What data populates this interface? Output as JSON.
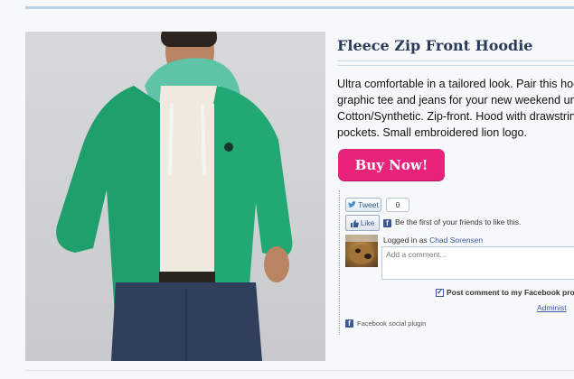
{
  "product": {
    "title": "Fleece Zip Front Hoodie",
    "description_lines": [
      "Ultra comfortable in a tailored look. Pair this hoodie",
      "graphic tee and jeans for your new weekend unifor",
      "Cotton/Synthetic. Zip-front. Hood with drawstrings.",
      "pockets. Small embroidered lion logo."
    ],
    "buy_label": "Buy Now!"
  },
  "social": {
    "tweet_label": "Tweet",
    "tweet_count": "0",
    "like_label": "Like",
    "like_text": "Be the first of your friends to like this.",
    "logged_in_prefix": "Logged in as",
    "user_name": "Chad Sorensen",
    "comment_placeholder": "Add a comment...",
    "post_to_facebook": "Post comment to my Facebook pro",
    "admin_link": "Administ",
    "plugin_label": "Facebook social plugin",
    "post_checked": true
  },
  "colors": {
    "accent": "#e8247a",
    "facebook_blue": "#3b5998",
    "title": "#2a3c5a",
    "hoodie_green": "#1fa66f"
  },
  "icons": [
    "twitter-bird-icon",
    "facebook-like-thumb-icon",
    "facebook-f-icon",
    "checkbox-icon"
  ]
}
